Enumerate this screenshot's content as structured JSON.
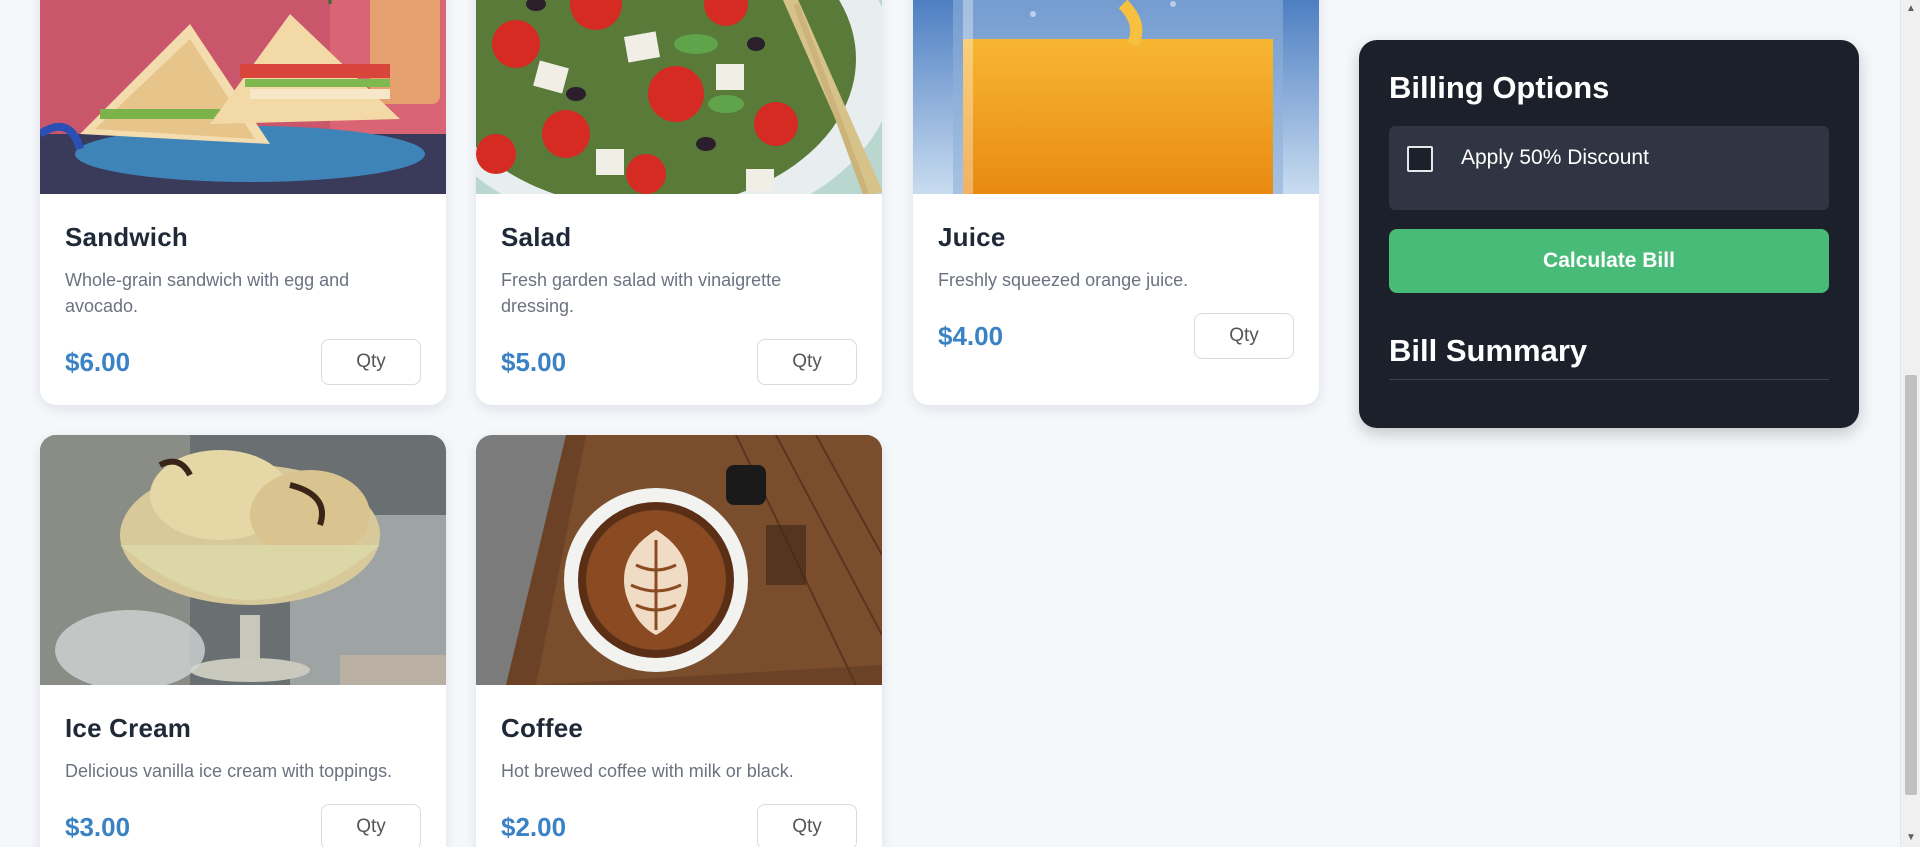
{
  "menu": {
    "qty_placeholder": "Qty",
    "items": [
      {
        "name": "Sandwich",
        "description": "Whole-grain sandwich with egg and avocado.",
        "price": "$6.00",
        "image": "sandwich-photo"
      },
      {
        "name": "Salad",
        "description": "Fresh garden salad with vinaigrette dressing.",
        "price": "$5.00",
        "image": "salad-photo"
      },
      {
        "name": "Juice",
        "description": "Freshly squeezed orange juice.",
        "price": "$4.00",
        "image": "orange-juice-photo"
      },
      {
        "name": "Ice Cream",
        "description": "Delicious vanilla ice cream with toppings.",
        "price": "$3.00",
        "image": "ice-cream-photo"
      },
      {
        "name": "Coffee",
        "description": "Hot brewed coffee with milk or black.",
        "price": "$2.00",
        "image": "coffee-photo"
      }
    ]
  },
  "billing": {
    "title": "Billing Options",
    "discount_label": "Apply 50% Discount",
    "discount_checked": false,
    "calculate_label": "Calculate Bill",
    "summary_title": "Bill Summary"
  },
  "colors": {
    "page_background": "#f5f8fb",
    "price": "#3b82c4",
    "panel_background": "#1b202b",
    "calculate_button": "#48bb78"
  }
}
